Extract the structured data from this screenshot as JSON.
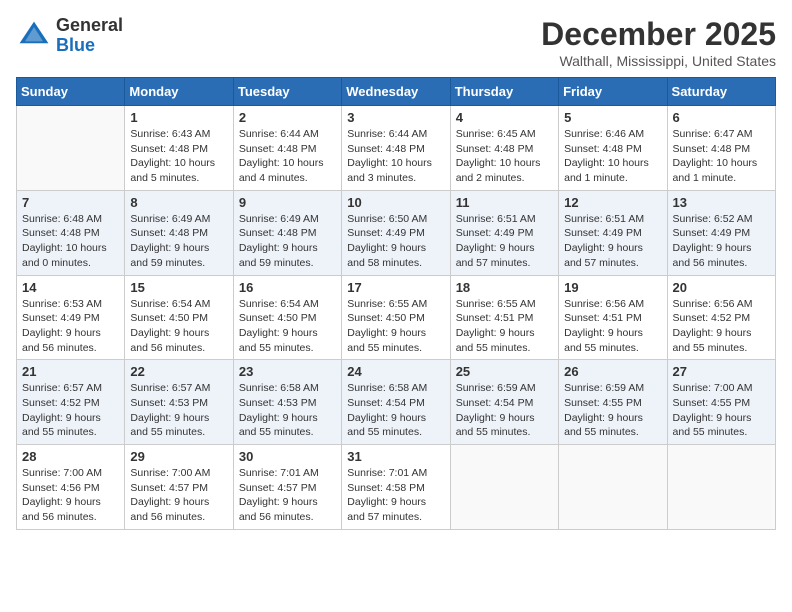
{
  "header": {
    "logo_line1": "General",
    "logo_line2": "Blue",
    "month": "December 2025",
    "location": "Walthall, Mississippi, United States"
  },
  "days_of_week": [
    "Sunday",
    "Monday",
    "Tuesday",
    "Wednesday",
    "Thursday",
    "Friday",
    "Saturday"
  ],
  "weeks": [
    [
      {
        "day": "",
        "sunrise": "",
        "sunset": "",
        "daylight": ""
      },
      {
        "day": "1",
        "sunrise": "Sunrise: 6:43 AM",
        "sunset": "Sunset: 4:48 PM",
        "daylight": "Daylight: 10 hours and 5 minutes."
      },
      {
        "day": "2",
        "sunrise": "Sunrise: 6:44 AM",
        "sunset": "Sunset: 4:48 PM",
        "daylight": "Daylight: 10 hours and 4 minutes."
      },
      {
        "day": "3",
        "sunrise": "Sunrise: 6:44 AM",
        "sunset": "Sunset: 4:48 PM",
        "daylight": "Daylight: 10 hours and 3 minutes."
      },
      {
        "day": "4",
        "sunrise": "Sunrise: 6:45 AM",
        "sunset": "Sunset: 4:48 PM",
        "daylight": "Daylight: 10 hours and 2 minutes."
      },
      {
        "day": "5",
        "sunrise": "Sunrise: 6:46 AM",
        "sunset": "Sunset: 4:48 PM",
        "daylight": "Daylight: 10 hours and 1 minute."
      },
      {
        "day": "6",
        "sunrise": "Sunrise: 6:47 AM",
        "sunset": "Sunset: 4:48 PM",
        "daylight": "Daylight: 10 hours and 1 minute."
      }
    ],
    [
      {
        "day": "7",
        "sunrise": "Sunrise: 6:48 AM",
        "sunset": "Sunset: 4:48 PM",
        "daylight": "Daylight: 10 hours and 0 minutes."
      },
      {
        "day": "8",
        "sunrise": "Sunrise: 6:49 AM",
        "sunset": "Sunset: 4:48 PM",
        "daylight": "Daylight: 9 hours and 59 minutes."
      },
      {
        "day": "9",
        "sunrise": "Sunrise: 6:49 AM",
        "sunset": "Sunset: 4:48 PM",
        "daylight": "Daylight: 9 hours and 59 minutes."
      },
      {
        "day": "10",
        "sunrise": "Sunrise: 6:50 AM",
        "sunset": "Sunset: 4:49 PM",
        "daylight": "Daylight: 9 hours and 58 minutes."
      },
      {
        "day": "11",
        "sunrise": "Sunrise: 6:51 AM",
        "sunset": "Sunset: 4:49 PM",
        "daylight": "Daylight: 9 hours and 57 minutes."
      },
      {
        "day": "12",
        "sunrise": "Sunrise: 6:51 AM",
        "sunset": "Sunset: 4:49 PM",
        "daylight": "Daylight: 9 hours and 57 minutes."
      },
      {
        "day": "13",
        "sunrise": "Sunrise: 6:52 AM",
        "sunset": "Sunset: 4:49 PM",
        "daylight": "Daylight: 9 hours and 56 minutes."
      }
    ],
    [
      {
        "day": "14",
        "sunrise": "Sunrise: 6:53 AM",
        "sunset": "Sunset: 4:49 PM",
        "daylight": "Daylight: 9 hours and 56 minutes."
      },
      {
        "day": "15",
        "sunrise": "Sunrise: 6:54 AM",
        "sunset": "Sunset: 4:50 PM",
        "daylight": "Daylight: 9 hours and 56 minutes."
      },
      {
        "day": "16",
        "sunrise": "Sunrise: 6:54 AM",
        "sunset": "Sunset: 4:50 PM",
        "daylight": "Daylight: 9 hours and 55 minutes."
      },
      {
        "day": "17",
        "sunrise": "Sunrise: 6:55 AM",
        "sunset": "Sunset: 4:50 PM",
        "daylight": "Daylight: 9 hours and 55 minutes."
      },
      {
        "day": "18",
        "sunrise": "Sunrise: 6:55 AM",
        "sunset": "Sunset: 4:51 PM",
        "daylight": "Daylight: 9 hours and 55 minutes."
      },
      {
        "day": "19",
        "sunrise": "Sunrise: 6:56 AM",
        "sunset": "Sunset: 4:51 PM",
        "daylight": "Daylight: 9 hours and 55 minutes."
      },
      {
        "day": "20",
        "sunrise": "Sunrise: 6:56 AM",
        "sunset": "Sunset: 4:52 PM",
        "daylight": "Daylight: 9 hours and 55 minutes."
      }
    ],
    [
      {
        "day": "21",
        "sunrise": "Sunrise: 6:57 AM",
        "sunset": "Sunset: 4:52 PM",
        "daylight": "Daylight: 9 hours and 55 minutes."
      },
      {
        "day": "22",
        "sunrise": "Sunrise: 6:57 AM",
        "sunset": "Sunset: 4:53 PM",
        "daylight": "Daylight: 9 hours and 55 minutes."
      },
      {
        "day": "23",
        "sunrise": "Sunrise: 6:58 AM",
        "sunset": "Sunset: 4:53 PM",
        "daylight": "Daylight: 9 hours and 55 minutes."
      },
      {
        "day": "24",
        "sunrise": "Sunrise: 6:58 AM",
        "sunset": "Sunset: 4:54 PM",
        "daylight": "Daylight: 9 hours and 55 minutes."
      },
      {
        "day": "25",
        "sunrise": "Sunrise: 6:59 AM",
        "sunset": "Sunset: 4:54 PM",
        "daylight": "Daylight: 9 hours and 55 minutes."
      },
      {
        "day": "26",
        "sunrise": "Sunrise: 6:59 AM",
        "sunset": "Sunset: 4:55 PM",
        "daylight": "Daylight: 9 hours and 55 minutes."
      },
      {
        "day": "27",
        "sunrise": "Sunrise: 7:00 AM",
        "sunset": "Sunset: 4:55 PM",
        "daylight": "Daylight: 9 hours and 55 minutes."
      }
    ],
    [
      {
        "day": "28",
        "sunrise": "Sunrise: 7:00 AM",
        "sunset": "Sunset: 4:56 PM",
        "daylight": "Daylight: 9 hours and 56 minutes."
      },
      {
        "day": "29",
        "sunrise": "Sunrise: 7:00 AM",
        "sunset": "Sunset: 4:57 PM",
        "daylight": "Daylight: 9 hours and 56 minutes."
      },
      {
        "day": "30",
        "sunrise": "Sunrise: 7:01 AM",
        "sunset": "Sunset: 4:57 PM",
        "daylight": "Daylight: 9 hours and 56 minutes."
      },
      {
        "day": "31",
        "sunrise": "Sunrise: 7:01 AM",
        "sunset": "Sunset: 4:58 PM",
        "daylight": "Daylight: 9 hours and 57 minutes."
      },
      {
        "day": "",
        "sunrise": "",
        "sunset": "",
        "daylight": ""
      },
      {
        "day": "",
        "sunrise": "",
        "sunset": "",
        "daylight": ""
      },
      {
        "day": "",
        "sunrise": "",
        "sunset": "",
        "daylight": ""
      }
    ]
  ]
}
